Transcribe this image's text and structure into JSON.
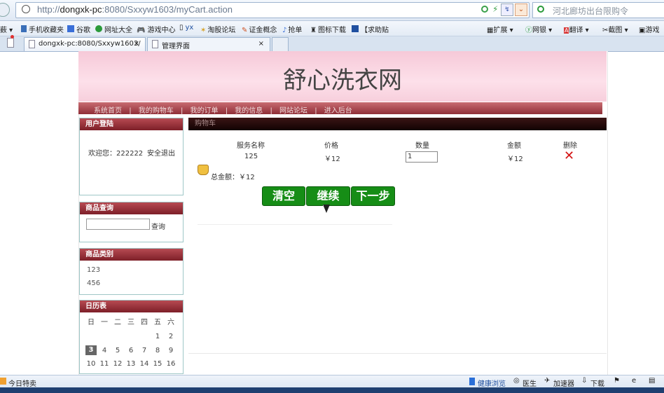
{
  "browser": {
    "url_prefix": "http://",
    "url_host": "dongxk-pc",
    "url_rest": ":8080/Sxxyw1603/myCart.action",
    "search_text": "河北廊坊出台限购令",
    "bookmarks": [
      "手机收藏夹",
      "谷歌",
      "网址大全",
      "游戏中心",
      "yx",
      "淘股论坛",
      "证金概念",
      "抢单",
      "图标下载",
      "【求助贴"
    ],
    "right_tools": [
      "扩展",
      "网银",
      "翻译",
      "截图",
      "游戏"
    ],
    "tabs": [
      {
        "label": "dongxk-pc:8080/Sxxyw1603/",
        "close": "×"
      },
      {
        "label": "管理界面",
        "close": "×"
      }
    ],
    "status_left": "今日特卖",
    "status_right": [
      "健康浏览",
      "医生",
      "加速器",
      "下载"
    ]
  },
  "site": {
    "title": "舒心洗衣网",
    "nav": [
      "系统首页",
      "我的购物车",
      "我的订单",
      "我的信息",
      "网站论坛",
      "进入后台"
    ],
    "nav_sep": "|"
  },
  "sidebar": {
    "login": {
      "header": "用户登陆",
      "welcome": "欢迎您：222222",
      "logout": "安全退出"
    },
    "search": {
      "header": "商品查询",
      "button": "查询"
    },
    "categories": {
      "header": "商品类别",
      "items": [
        "123",
        "456"
      ]
    },
    "calendar": {
      "header": "日历表",
      "weekdays": [
        "日",
        "一",
        "二",
        "三",
        "四",
        "五",
        "六"
      ],
      "row1": [
        "",
        "",
        "",
        "",
        "",
        "1",
        "2"
      ],
      "row2": [
        "3",
        "4",
        "5",
        "6",
        "7",
        "8",
        "9"
      ],
      "row3": [
        "10",
        "11",
        "12",
        "13",
        "14",
        "15",
        "16"
      ],
      "today": "3"
    }
  },
  "cart": {
    "caption": "购物车",
    "headers": {
      "name": "服务名称",
      "price": "价格",
      "qty": "数量",
      "amount": "金额",
      "delete": "删除"
    },
    "row": {
      "name": "125",
      "price": "￥12",
      "qty": "1",
      "amount": "￥12"
    },
    "total_label": "总金额：￥12",
    "buttons": {
      "clear": "清空",
      "continue": "继续",
      "next": "下一步"
    }
  },
  "colors": {
    "banner": "#f8d0dd",
    "nav": "#a8434b",
    "button": "#168d16",
    "delete": "#d41414"
  }
}
